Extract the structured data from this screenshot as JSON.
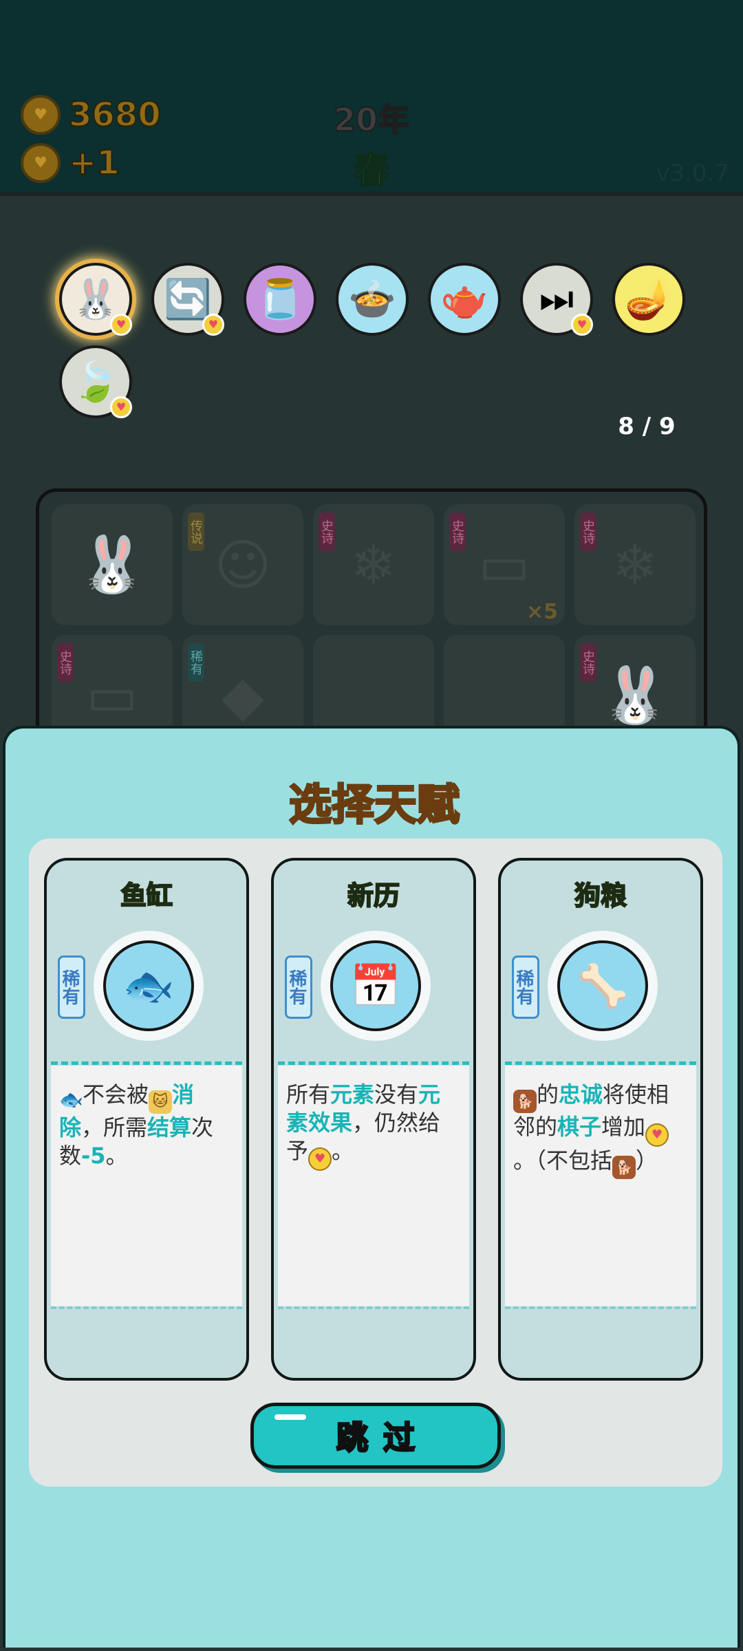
{
  "status": {
    "coins": "3680",
    "income": "+1",
    "year": "20年",
    "season": "春",
    "version": "v3.0.7"
  },
  "talents": {
    "items": [
      {
        "name": "rabbit-icon",
        "glyph": "🐰",
        "bg": "#f1e9dc",
        "badge": true,
        "selected": true
      },
      {
        "name": "refresh-icon",
        "glyph": "🔄",
        "bg": "#d9dcd3",
        "badge": true,
        "selected": false
      },
      {
        "name": "jar-icon",
        "glyph": "🫙",
        "bg": "#c693df",
        "badge": false,
        "selected": false
      },
      {
        "name": "pot-duck-icon",
        "glyph": "🍲",
        "bg": "#a6e2f1",
        "badge": false,
        "selected": false
      },
      {
        "name": "gravy-boat-icon",
        "glyph": "🫖",
        "bg": "#a6e2f1",
        "badge": false,
        "selected": false
      },
      {
        "name": "skip-end-icon",
        "glyph": "⏭",
        "bg": "#d9dcd3",
        "badge": true,
        "selected": false
      },
      {
        "name": "magic-lamp-icon",
        "glyph": "🪔",
        "bg": "#f6ec6f",
        "badge": false,
        "selected": false
      },
      {
        "name": "leaf-icon",
        "glyph": "🍃",
        "bg": "#d9dcd3",
        "badge": true,
        "selected": false
      }
    ],
    "count": "8 / 9"
  },
  "board": {
    "cells": [
      {
        "icon": "🐰",
        "tag": "",
        "tag_style": "",
        "extra": ""
      },
      {
        "icon": "☺",
        "tag": "传说",
        "tag_style": "gold",
        "extra": ""
      },
      {
        "icon": "❄",
        "tag": "史诗",
        "tag_style": "pink",
        "extra": ""
      },
      {
        "icon": "▭",
        "tag": "史诗",
        "tag_style": "pink",
        "extra": "×5"
      },
      {
        "icon": "❄",
        "tag": "史诗",
        "tag_style": "pink",
        "extra": ""
      },
      {
        "icon": "▭",
        "tag": "史诗",
        "tag_style": "pink",
        "extra": ""
      },
      {
        "icon": "◆",
        "tag": "稀有",
        "tag_style": "teal",
        "extra": ""
      },
      {
        "icon": "",
        "tag": "",
        "tag_style": "",
        "extra": ""
      },
      {
        "icon": "",
        "tag": "",
        "tag_style": "",
        "extra": ""
      },
      {
        "icon": "🐰",
        "tag": "史诗",
        "tag_style": "pink",
        "extra": ""
      }
    ]
  },
  "modal": {
    "title": "选择天赋",
    "skip_label": "跳过",
    "cards": [
      {
        "name": "鱼缸",
        "rarity": "稀有",
        "icon": "fishbowl-icon",
        "glyph": "🐟",
        "desc_parts": [
          {
            "t": "icon",
            "k": "fish",
            "v": "🐟"
          },
          {
            "t": "text",
            "v": "不会被"
          },
          {
            "t": "icon",
            "k": "cat",
            "v": "🐱"
          },
          {
            "t": "hl",
            "v": "消除"
          },
          {
            "t": "text",
            "v": "，所需"
          },
          {
            "t": "hl",
            "v": "结算"
          },
          {
            "t": "text",
            "v": "次数"
          },
          {
            "t": "hl",
            "v": "-5"
          },
          {
            "t": "text",
            "v": "。"
          }
        ]
      },
      {
        "name": "新历",
        "rarity": "稀有",
        "icon": "calendar-icon",
        "glyph": "📅",
        "desc_parts": [
          {
            "t": "text",
            "v": "所有"
          },
          {
            "t": "hl",
            "v": "元素"
          },
          {
            "t": "text",
            "v": "没有"
          },
          {
            "t": "hl",
            "v": "元素效果"
          },
          {
            "t": "text",
            "v": "，仍然给予"
          },
          {
            "t": "icon",
            "k": "coin",
            "v": "♥"
          },
          {
            "t": "text",
            "v": "。"
          }
        ]
      },
      {
        "name": "狗粮",
        "rarity": "稀有",
        "icon": "dog-food-icon",
        "glyph": "🦴",
        "desc_parts": [
          {
            "t": "icon",
            "k": "dog",
            "v": "🐕"
          },
          {
            "t": "text",
            "v": "的"
          },
          {
            "t": "hl",
            "v": "忠诚"
          },
          {
            "t": "text",
            "v": "将使相邻的"
          },
          {
            "t": "hl",
            "v": "棋子"
          },
          {
            "t": "text",
            "v": "增加"
          },
          {
            "t": "icon",
            "k": "coin",
            "v": "♥"
          },
          {
            "t": "text",
            "v": "。（不包括"
          },
          {
            "t": "icon",
            "k": "dog",
            "v": "🐕"
          },
          {
            "t": "text",
            "v": "）"
          }
        ]
      }
    ]
  }
}
